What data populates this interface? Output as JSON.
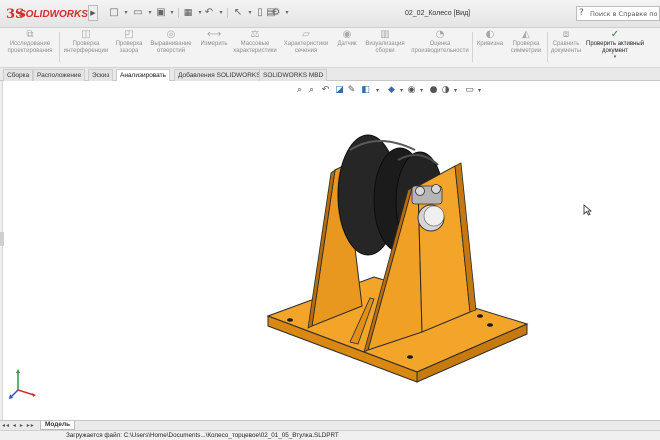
{
  "app": {
    "logo_mark": "3S",
    "logo_text": "SOLIDWORKS",
    "menu_arrow": "▶"
  },
  "window": {
    "title": "02_02_Колесо [Вид]"
  },
  "help_search": {
    "placeholder": "Поиск в Справке по SOLIDWORKS"
  },
  "command_manager": {
    "items": [
      {
        "label": "Исследование проектирования",
        "icon": "design-study-icon"
      },
      {
        "label": "Проверка интерференции",
        "icon": "interference-icon"
      },
      {
        "label": "Проверка зазора",
        "icon": "clearance-icon"
      },
      {
        "label": "Выравнивание отверстий",
        "icon": "hole-alignment-icon"
      },
      {
        "label": "Измерить",
        "icon": "measure-icon"
      },
      {
        "label": "Массовые характеристики",
        "icon": "mass-properties-icon"
      },
      {
        "label": "Характеристики сечения",
        "icon": "section-properties-icon"
      },
      {
        "label": "Датчик",
        "icon": "sensor-icon"
      },
      {
        "label": "Визуализация сборки",
        "icon": "assembly-visualization-icon"
      },
      {
        "label": "Оценка производительности",
        "icon": "performance-icon"
      },
      {
        "label": "Кривизна",
        "icon": "curvature-icon"
      },
      {
        "label": "Проверка симметрии",
        "icon": "symmetry-icon"
      },
      {
        "label": "Сравнить документы",
        "icon": "compare-icon"
      },
      {
        "label": "Проверить активный документ",
        "icon": "check-document-icon"
      }
    ]
  },
  "tabs": [
    {
      "label": "Сборка"
    },
    {
      "label": "Расположение"
    },
    {
      "label": "Эскиз"
    },
    {
      "label": "Анализировать",
      "active": true
    },
    {
      "label": "Добавления SOLIDWORKS"
    },
    {
      "label": "SOLIDWORKS MBD"
    }
  ],
  "bottom_tabs": {
    "arrows": "◂◂ ◂ ▸ ▸▸",
    "model": "Модель"
  },
  "status": {
    "text": "Загружается файл: C:\\Users\\Home\\Documents...\\Колесо_торцевое\\02_01_05_Втулка.SLDPRT"
  },
  "colors": {
    "brand": "#d22c2c",
    "model_orange": "#f0a025",
    "wheel_black": "#1c1c1c",
    "check_green": "#2c8a3b"
  }
}
